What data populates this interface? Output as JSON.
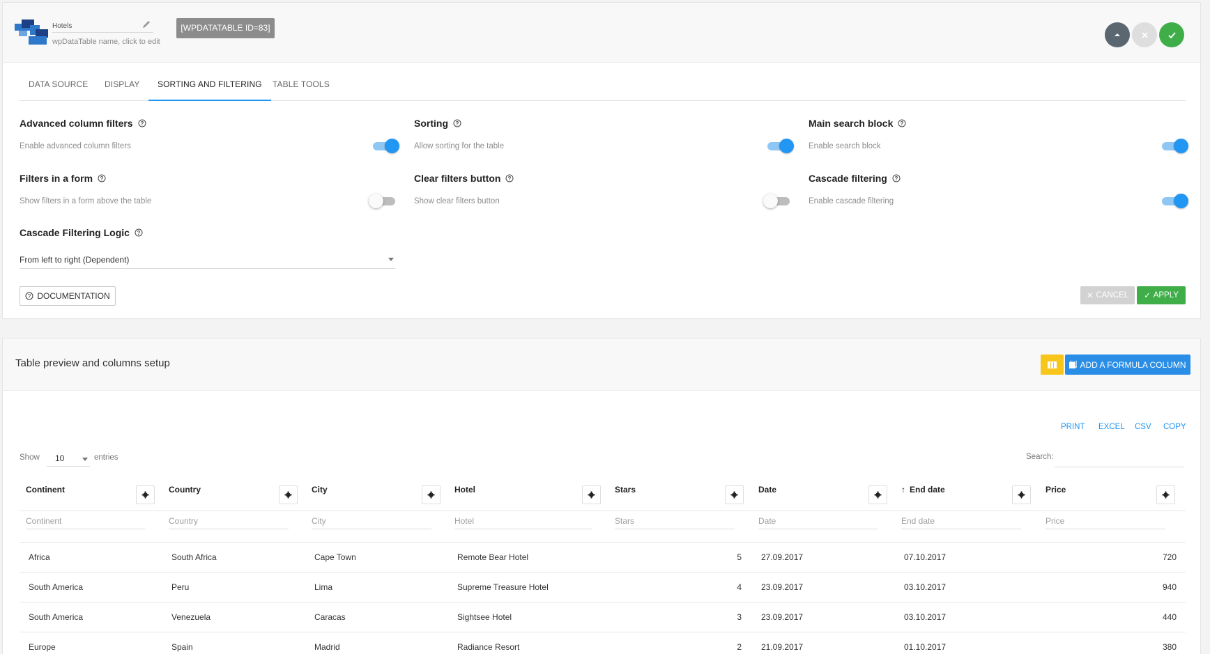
{
  "header": {
    "table_name": "Hotels",
    "name_hint": "wpDataTable name, click to edit",
    "shortcode": "[WPDATATABLE ID=83]"
  },
  "tabs": [
    "DATA SOURCE",
    "DISPLAY",
    "SORTING AND FILTERING",
    "TABLE TOOLS"
  ],
  "active_tab": "SORTING AND FILTERING",
  "settings": {
    "advanced_filters": {
      "title": "Advanced column filters",
      "desc": "Enable advanced column filters",
      "enabled": true
    },
    "sorting": {
      "title": "Sorting",
      "desc": "Allow sorting for the table",
      "enabled": true
    },
    "main_search": {
      "title": "Main search block",
      "desc": "Enable search block",
      "enabled": true
    },
    "filters_form": {
      "title": "Filters in a form",
      "desc": "Show filters in a form above the table",
      "enabled": false
    },
    "clear_filters": {
      "title": "Clear filters button",
      "desc": "Show clear filters button",
      "enabled": false
    },
    "cascade": {
      "title": "Cascade filtering",
      "desc": "Enable cascade filtering",
      "enabled": true
    },
    "cascade_logic": {
      "title": "Cascade Filtering Logic",
      "value": "From left to right (Dependent)"
    }
  },
  "buttons": {
    "documentation": "DOCUMENTATION",
    "cancel": "CANCEL",
    "apply": "APPLY"
  },
  "preview": {
    "title": "Table preview and columns setup",
    "add_formula": "ADD A FORMULA COLUMN",
    "export": [
      "PRINT",
      "EXCEL",
      "CSV",
      "COPY"
    ],
    "show_label": "Show",
    "entries_value": "10",
    "entries_label": "entries",
    "search_label": "Search:",
    "columns": [
      "Continent",
      "Country",
      "City",
      "Hotel",
      "Stars",
      "Date",
      "End date",
      "Price"
    ],
    "sorted_column": "End date",
    "filters": [
      "Continent",
      "Country",
      "City",
      "Hotel",
      "Stars",
      "Date",
      "End date",
      "Price"
    ],
    "rows": [
      [
        "Africa",
        "South Africa",
        "Cape Town",
        "Remote Bear Hotel",
        "5",
        "27.09.2017",
        "07.10.2017",
        "720"
      ],
      [
        "South America",
        "Peru",
        "Lima",
        "Supreme Treasure Hotel",
        "4",
        "23.09.2017",
        "03.10.2017",
        "940"
      ],
      [
        "South America",
        "Venezuela",
        "Caracas",
        "Sightsee Hotel",
        "3",
        "23.09.2017",
        "03.10.2017",
        "440"
      ],
      [
        "Europe",
        "Spain",
        "Madrid",
        "Radiance Resort",
        "2",
        "21.09.2017",
        "01.10.2017",
        "380"
      ]
    ]
  },
  "colors": {
    "accent": "#2196f3",
    "success": "#3fae49",
    "warning": "#f8c51a"
  }
}
